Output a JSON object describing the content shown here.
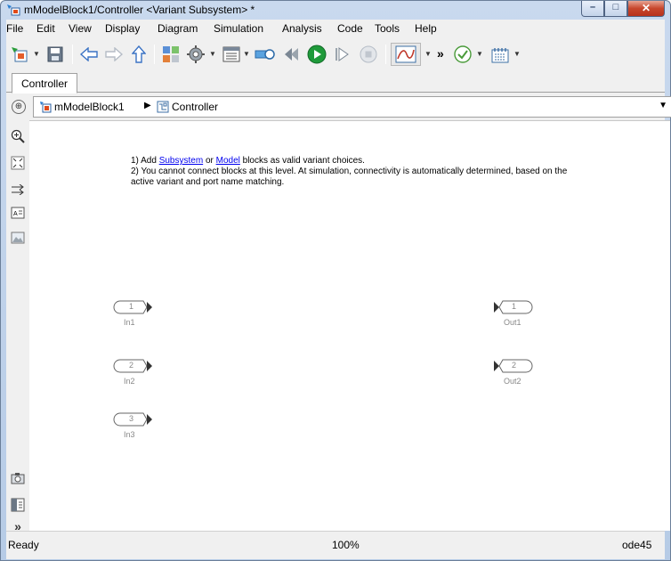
{
  "window": {
    "title": "mModelBlock1/Controller <Variant Subsystem> *",
    "minimize_glyph": "–",
    "maximize_glyph": "□",
    "close_glyph": "✕"
  },
  "menu": [
    {
      "id": "file",
      "label": "File"
    },
    {
      "id": "edit",
      "label": "Edit"
    },
    {
      "id": "view",
      "label": "View"
    },
    {
      "id": "display",
      "label": "Display"
    },
    {
      "id": "diagram",
      "label": "Diagram"
    },
    {
      "id": "simulation",
      "label": "Simulation"
    },
    {
      "id": "analysis",
      "label": "Analysis"
    },
    {
      "id": "code",
      "label": "Code"
    },
    {
      "id": "tools",
      "label": "Tools"
    },
    {
      "id": "help",
      "label": "Help"
    }
  ],
  "toolbar": {
    "more_glyph": "»",
    "dropdown_glyph": "▼"
  },
  "tabs": {
    "active": "Controller"
  },
  "breadcrumb": {
    "root": "mModelBlock1",
    "current": "Controller",
    "separator": "▶",
    "toggle_glyph": "⊕",
    "dropdown_glyph": "▼"
  },
  "palette": {
    "more_glyph": "»"
  },
  "note": {
    "line1_prefix": "1) Add ",
    "link_subsystem": "Subsystem",
    "line1_mid": " or ",
    "link_model": "Model",
    "line1_suffix": " blocks as valid variant choices.",
    "line2": "2) You cannot connect blocks at this level. At simulation, connectivity is automatically determined, based on the active variant and port name matching."
  },
  "inports": [
    {
      "num": "1",
      "name": "In1"
    },
    {
      "num": "2",
      "name": "In2"
    },
    {
      "num": "3",
      "name": "In3"
    }
  ],
  "outports": [
    {
      "num": "1",
      "name": "Out1"
    },
    {
      "num": "2",
      "name": "Out2"
    }
  ],
  "status": {
    "state": "Ready",
    "zoom": "100%",
    "solver": "ode45"
  }
}
